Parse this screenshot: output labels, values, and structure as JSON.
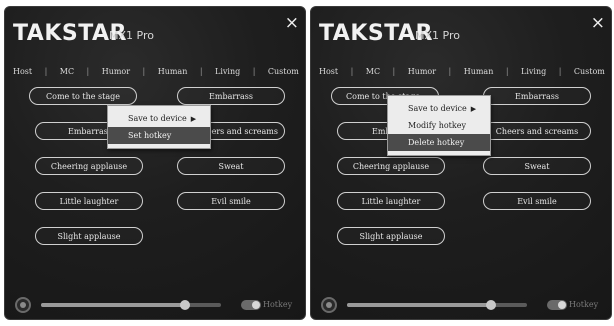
{
  "left_panel": {
    "brand": "TAKSTAR",
    "model": "MX1 Pro",
    "close": "×",
    "tabs": [
      "Host",
      "MC",
      "Humor",
      "Human",
      "Living",
      "Custom"
    ],
    "buttons": [
      "Come to the stage",
      "Embarrass",
      "Embarrassed",
      "Cheers and screams",
      "Cheering applause",
      "Sweat",
      "Little laughter",
      "Evil smile",
      "Slight applause"
    ],
    "menu": {
      "item1": "Save to device",
      "item2": "Set hotkey"
    },
    "footer": {
      "toggle_label": "Hotkey",
      "slider_value": 0.8
    }
  },
  "right_panel": {
    "brand": "TAKSTAR",
    "model": "MX1 Pro",
    "close": "×",
    "tabs": [
      "Host",
      "MC",
      "Humor",
      "Human",
      "Living",
      "Custom"
    ],
    "buttons": [
      "Come to the stage",
      "Embarrass",
      "Embarrassed",
      "Cheers and screams",
      "Cheering applause",
      "Sweat",
      "Little laughter",
      "Evil smile",
      "Slight applause"
    ],
    "menu": {
      "item1": "Save to device",
      "item2": "Modify hotkey",
      "item3": "Delete hotkey"
    },
    "footer": {
      "toggle_label": "Hotkey",
      "slider_value": 0.8
    }
  },
  "colors": {
    "panel_bg": "#1e1e1e",
    "highlight": "#4b4b4b",
    "menu_bg": "#ececec"
  }
}
